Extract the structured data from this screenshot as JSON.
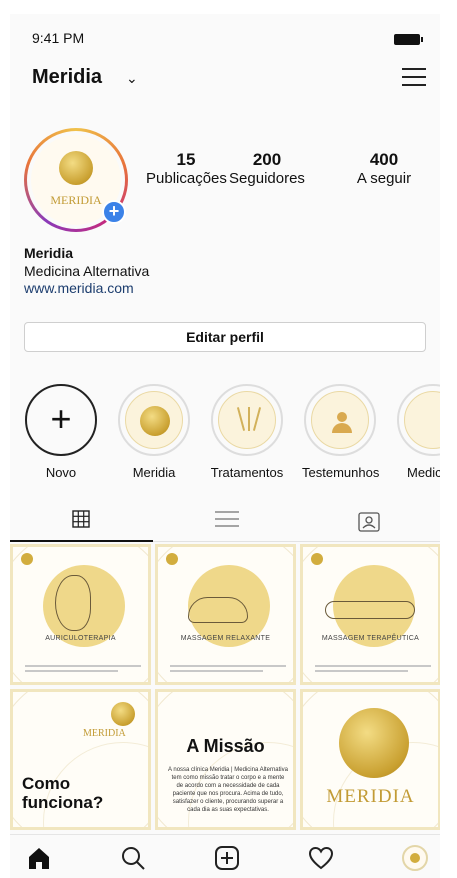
{
  "status_bar": {
    "time": "9:41 PM"
  },
  "header": {
    "username": "Meridia",
    "dropdown_glyph": "⌄"
  },
  "profile": {
    "avatar_text": "MERIDIA",
    "stats": [
      {
        "number": "15",
        "label": "Publicações"
      },
      {
        "number": "200",
        "label": "Seguidores"
      },
      {
        "number": "400",
        "label": "A seguir"
      }
    ],
    "bio_name": "Meridia",
    "bio_category": "Medicina Alternativa",
    "bio_link": "www.meridia.com",
    "edit_button": "Editar perfil"
  },
  "highlights": [
    {
      "label": "Novo"
    },
    {
      "label": "Meridia"
    },
    {
      "label": "Tratamentos"
    },
    {
      "label": "Testemunhos"
    },
    {
      "label": "Medicina"
    }
  ],
  "tabs": [
    "grid-icon",
    "list-icon",
    "tagged-icon"
  ],
  "posts": {
    "auriculoterapia": "AURICULOTERAPIA",
    "massagem_relaxante": "MASSAGEM RELAXANTE",
    "massagem_terapeutica": "MASSAGEM TERAPÊUTICA",
    "logo_small_text": "MERIDIA",
    "como_funciona": "Como funciona?",
    "missao_title": "A Missão",
    "missao_text": "A nossa clínica Meridia | Medicina Alternativa tem como missão tratar o corpo e a mente de acordo com a necessidade de cada paciente que nos procura. Acima de tudo, satisfazer o cliente, procurando superar a cada dia as suas expectativas.",
    "logo_big_text": "MERIDIA"
  },
  "bottom_nav": [
    "home-icon",
    "search-icon",
    "new-post-icon",
    "heart-icon",
    "profile-icon"
  ],
  "colors": {
    "gold": "#c9a030",
    "accent_blue": "#3b82e8"
  }
}
